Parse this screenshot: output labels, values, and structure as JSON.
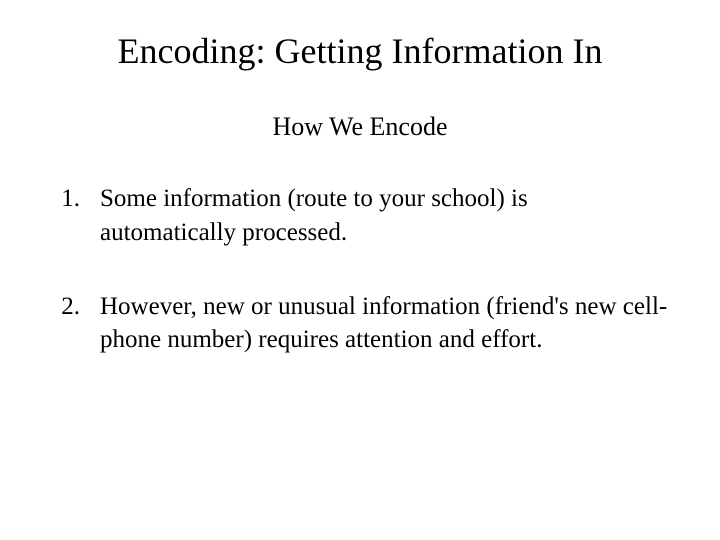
{
  "title": "Encoding: Getting Information In",
  "subtitle": "How We Encode",
  "items": [
    {
      "number": "1.",
      "text": "Some information (route to your school) is automatically processed."
    },
    {
      "number": "2.",
      "text": "However, new or unusual information (friend's new cell-phone number) requires attention and effort."
    }
  ]
}
